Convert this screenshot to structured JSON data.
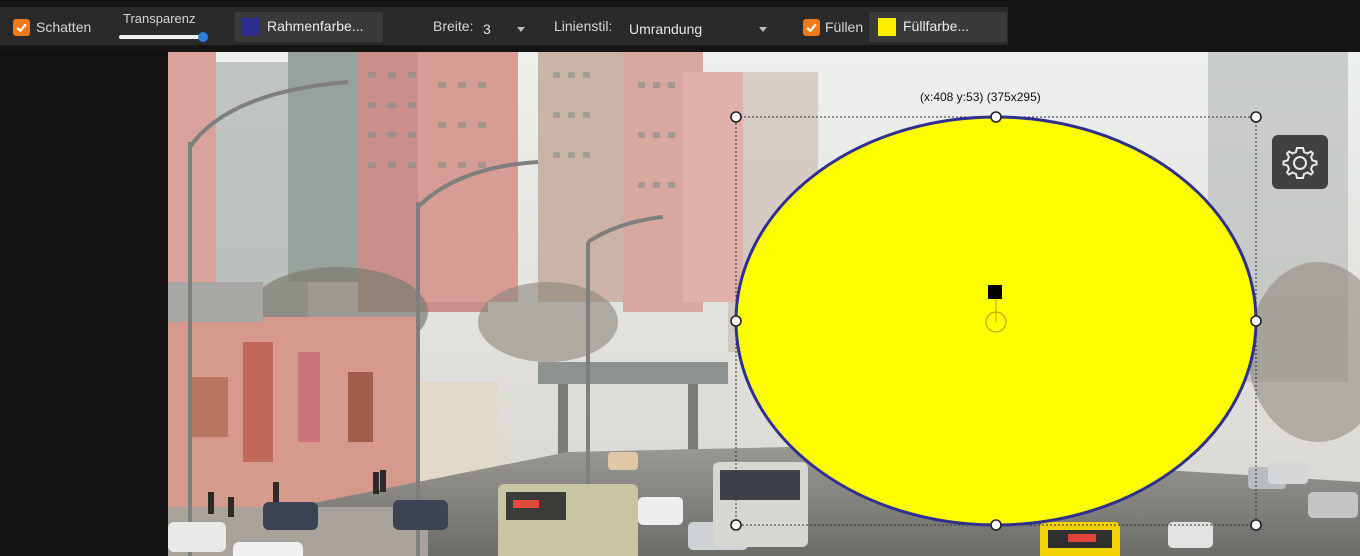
{
  "toolbar": {
    "shadow": {
      "label": "Schatten",
      "checked": true
    },
    "transparency": {
      "label": "Transparenz",
      "value": 1.0
    },
    "border_color": {
      "label": "Rahmenfarbe...",
      "color": "#2e2f8f"
    },
    "width": {
      "label": "Breite:",
      "value": "3"
    },
    "line_style": {
      "label": "Linienstil:",
      "value": "Umrandung"
    },
    "fill": {
      "label": "Füllen",
      "checked": true
    },
    "fill_color": {
      "label": "Füllfarbe...",
      "color": "#ffee00"
    }
  },
  "selection": {
    "label": "(x:408 y:53) (375x295)"
  },
  "shape": {
    "type": "ellipse",
    "fill": "#ffff00",
    "stroke": "#2e2f8f"
  },
  "colors": {
    "accent_check": "#f07a1a",
    "slider_thumb": "#2f7fe0"
  },
  "icons": {
    "settings": "gear-icon"
  }
}
